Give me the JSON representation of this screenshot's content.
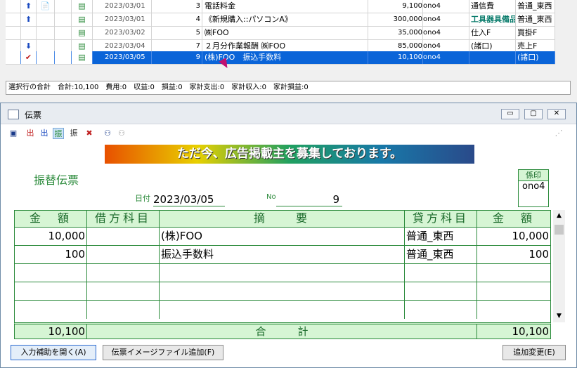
{
  "grid": {
    "rows": [
      {
        "icon1": "⬆",
        "icon2": "📄",
        "icon3": "▤",
        "date": "2023/03/01",
        "no": "3",
        "desc": "電話料金",
        "amount": "9,100",
        "user": "ono4",
        "debit": "通信費",
        "credit": "普通_東西"
      },
      {
        "icon1": "⬆",
        "icon2": "",
        "icon3": "▤",
        "date": "2023/03/01",
        "no": "4",
        "desc": "《新規購入::パソコンA》",
        "amount": "300,000",
        "user": "ono4",
        "debit": "工具器具備品",
        "credit": "普通_東西"
      },
      {
        "icon1": "",
        "icon2": "",
        "icon3": "▤",
        "date": "2023/03/02",
        "no": "5",
        "desc": "㈱FOO",
        "amount": "35,000",
        "user": "ono4",
        "debit": "仕入F",
        "credit": "買掛F"
      },
      {
        "icon1": "⬇",
        "icon2": "",
        "icon3": "▤",
        "date": "2023/03/04",
        "no": "7",
        "desc": "２月分作業報酬 ㈱FOO",
        "amount": "85,000",
        "user": "ono4",
        "debit": "(諸口)",
        "credit": "売上F"
      },
      {
        "icon1": "✔",
        "icon2": "",
        "icon3": "▤",
        "date": "2023/03/05",
        "no": "9",
        "desc": "(株)FOO　振込手数料",
        "amount": "10,100",
        "user": "ono4",
        "debit": "",
        "credit": "(諸口)"
      }
    ]
  },
  "status": "選択行の合計　合計:10,100　費用:0　収益:0　損益:0　家計支出:0　家計収入:0　家計損益:0",
  "window": {
    "title": "伝票",
    "minimize": "▭",
    "restore": "▢",
    "close": "✕"
  },
  "banner": "ただ今、広告掲載主を募集しております。",
  "voucher": {
    "title": "振替伝票",
    "stamp_header": "係印",
    "stamp_value": "ono4",
    "date_label": "日付",
    "date": "2023/03/05",
    "no_label": "No",
    "no": "9"
  },
  "table": {
    "headers": [
      "金　額",
      "借方科目",
      "摘　　要",
      "貸方科目",
      "金　額"
    ],
    "rows": [
      {
        "debit_amount": "10,000",
        "debit_account": "",
        "desc": "(株)FOO",
        "credit_account": "普通_東西",
        "credit_amount": "10,000"
      },
      {
        "debit_amount": "100",
        "debit_account": "",
        "desc": "振込手数料",
        "credit_account": "普通_東西",
        "credit_amount": "100"
      },
      {
        "debit_amount": "",
        "debit_account": "",
        "desc": "",
        "credit_account": "",
        "credit_amount": ""
      },
      {
        "debit_amount": "",
        "debit_account": "",
        "desc": "",
        "credit_account": "",
        "credit_amount": ""
      },
      {
        "debit_amount": "",
        "debit_account": "",
        "desc": "",
        "credit_account": "",
        "credit_amount": ""
      }
    ],
    "total_label": "合　　　計",
    "total_debit": "10,100",
    "total_credit": "10,100"
  },
  "buttons": {
    "assist": "入力補助を開く(A)",
    "image": "伝票イメージファイル追加(F)",
    "update": "追加変更(E)"
  },
  "toolbar": {
    "icons": [
      "register-icon",
      "red-voucher-icon",
      "blue-voucher-icon",
      "green-voucher-icon",
      "black-voucher-icon",
      "red-delete-icon",
      "binoculars-icon",
      "binoculars-gray-icon"
    ]
  }
}
